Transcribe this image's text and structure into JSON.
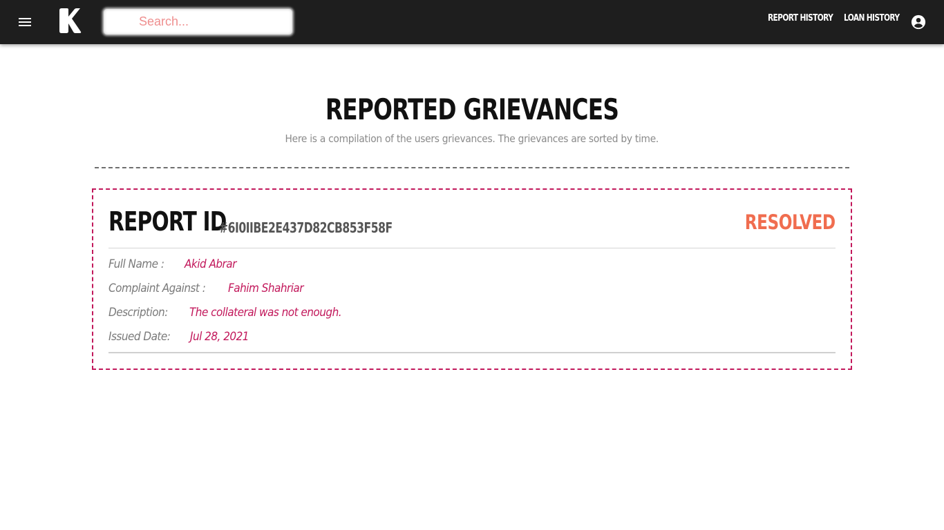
{
  "search": {
    "placeholder": "Search..."
  },
  "nav": {
    "report_history": "Report History",
    "loan_history": "Loan History"
  },
  "header": {
    "title": "Reported Grievances",
    "subtitle": "Here is a compilation of the users grievances. The grievances are sorted by time."
  },
  "report": {
    "label": "Report ID",
    "id": "#6I0IIBE2E437D82CB853F58F",
    "status": "Resolved",
    "fields": [
      {
        "label": "Full Name :",
        "value": "Akid Abrar"
      },
      {
        "label": "Complaint Against :",
        "value": "Fahim Shahriar"
      },
      {
        "label": "Description:",
        "value": "The collateral was not enough."
      },
      {
        "label": "Issued Date:",
        "value": "Jul 28, 2021"
      }
    ]
  },
  "colors": {
    "topbar": "#1e1e1e",
    "accent": "#c2185b",
    "status_resolved": "#f06d4f",
    "search_placeholder": "#ef8f8f"
  },
  "icons": {
    "menu": "menu-icon",
    "logo": "k-logo-icon",
    "account": "account-circle-icon"
  }
}
